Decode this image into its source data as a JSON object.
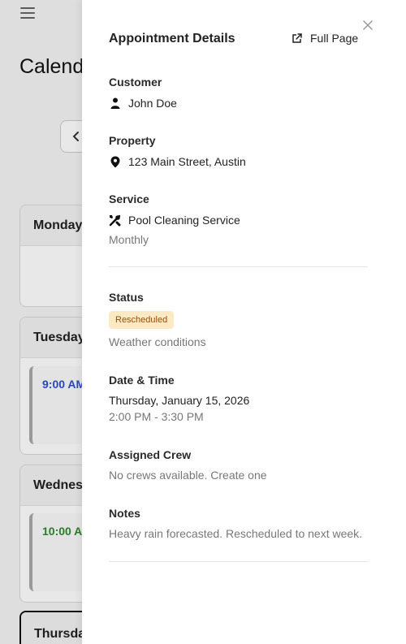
{
  "background": {
    "page_title": "Calend",
    "prev_icon": "chevron-left-icon",
    "days": [
      {
        "name": "Monday"
      },
      {
        "name": "Tuesday",
        "time": "9:00 AM",
        "time_color": "#2d4fd1"
      },
      {
        "name": "Wednes",
        "time": "10:00 A",
        "time_color": "#2e8a2e"
      },
      {
        "name": "Thursda"
      }
    ]
  },
  "drawer": {
    "title": "Appointment Details",
    "full_page_label": "Full Page",
    "close_icon": "close-icon",
    "customer": {
      "label": "Customer",
      "name": "John Doe",
      "icon": "person-icon"
    },
    "property": {
      "label": "Property",
      "address": "123 Main Street, Austin",
      "icon": "map-pin-icon"
    },
    "service": {
      "label": "Service",
      "name": "Pool Cleaning Service",
      "frequency": "Monthly",
      "icon": "tools-icon"
    },
    "status": {
      "label": "Status",
      "badge": "Rescheduled",
      "reason": "Weather conditions",
      "badge_bg": "#fde9c4",
      "badge_fg": "#9a4d06"
    },
    "datetime": {
      "label": "Date & Time",
      "date": "Thursday, January 15, 2026",
      "time": "2:00 PM - 3:30 PM"
    },
    "crew": {
      "label": "Assigned Crew",
      "text": "No crews available. Create one"
    },
    "notes": {
      "label": "Notes",
      "text": "Heavy rain forecasted. Rescheduled to next week."
    }
  }
}
